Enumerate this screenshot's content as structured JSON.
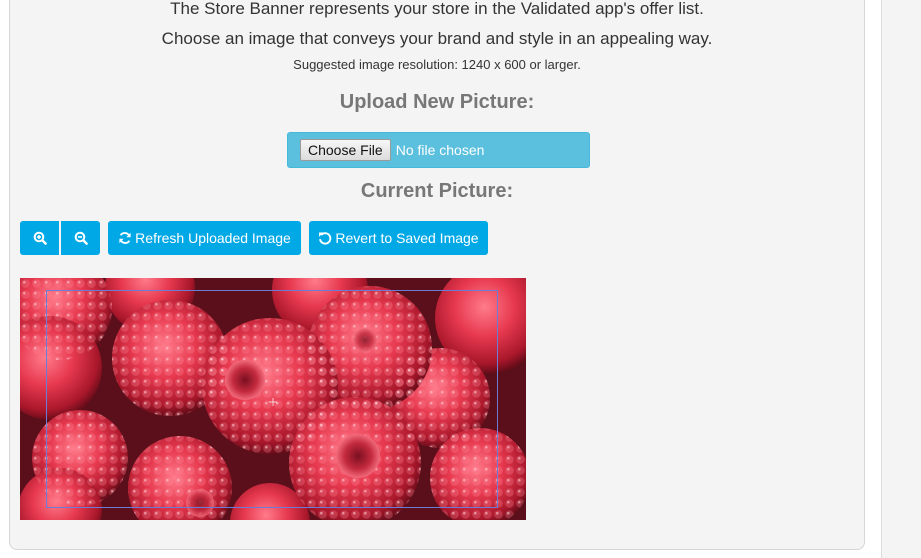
{
  "intro": {
    "line1": "The Store Banner represents your store in the Validated app's offer list.",
    "line2": "Choose an image that conveys your brand and style in an appealing way.",
    "hint": "Suggested image resolution: 1240 x 600 or larger."
  },
  "upload": {
    "heading": "Upload New Picture:",
    "choose_label": "Choose File",
    "status": "No file chosen"
  },
  "current": {
    "heading": "Current Picture:"
  },
  "toolbar": {
    "zoom_in_icon": "zoom-in-icon",
    "zoom_out_icon": "zoom-out-icon",
    "refresh_label": "Refresh Uploaded Image",
    "revert_label": "Revert to Saved Image"
  },
  "colors": {
    "button": "#00a8e6",
    "file_box": "#5bc0de",
    "heading": "#777777",
    "crop_border": "#6b7bd8"
  }
}
